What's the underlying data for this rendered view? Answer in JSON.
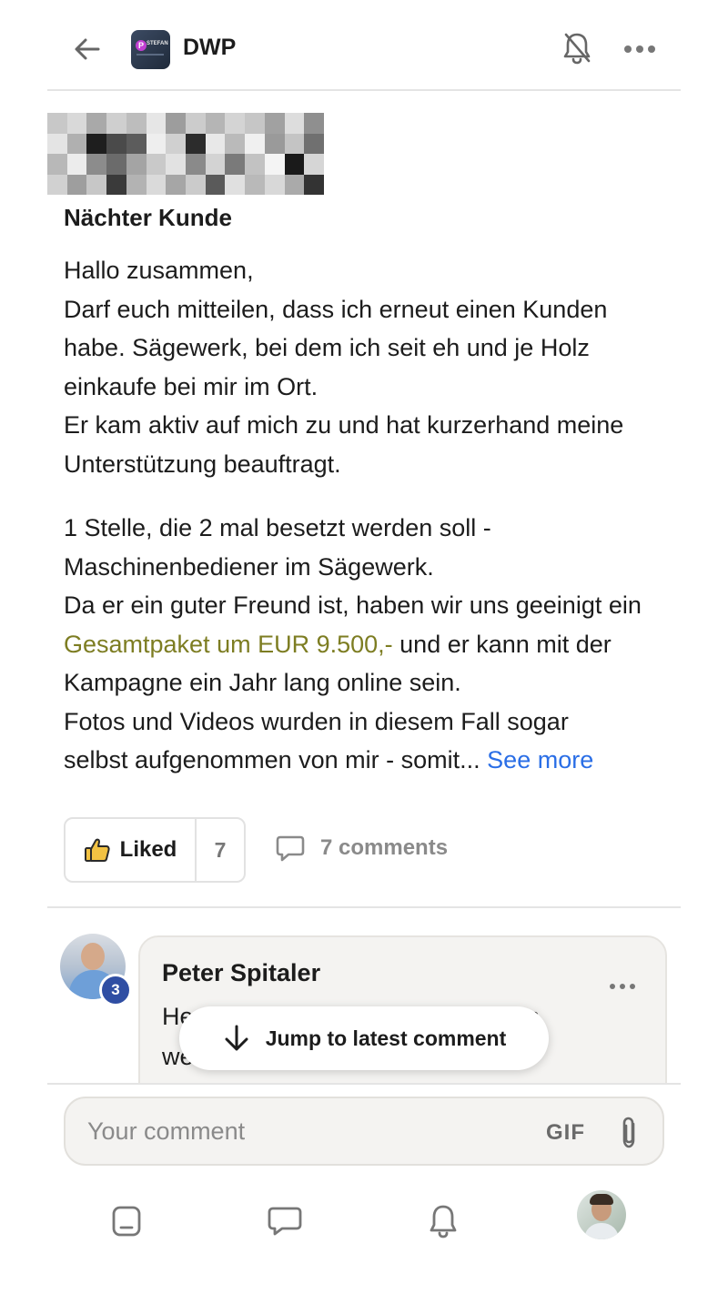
{
  "header": {
    "group_name": "DWP",
    "logo_text": "STEFAN",
    "logo_letter": "P"
  },
  "post": {
    "title": "Nächter Kunde",
    "paragraph1": [
      "Hallo zusammen,",
      "Darf euch mitteilen, dass ich erneut einen Kunden",
      "habe. Sägewerk, bei dem ich seit eh und je Holz",
      "einkaufe bei mir im Ort.",
      "Er kam aktiv auf mich zu und hat kurzerhand meine",
      "Unterstützung beauftragt."
    ],
    "paragraph2_lines": [
      "1 Stelle, die 2 mal besetzt werden soll -",
      "Maschinenbediener im Sägewerk.",
      "Da er ein guter Freund ist, haben wir uns geeinigt ein"
    ],
    "highlighted": "Gesamtpaket um EUR 9.500,-",
    "after_highlight": " und er kann mit der",
    "paragraph2_rest": [
      "Kampagne ein Jahr lang online sein.",
      "Fotos und Videos wurden in diesem Fall sogar"
    ],
    "last_line": "selbst aufgenommen von mir - somit... ",
    "see_more": "See more"
  },
  "reactions": {
    "liked_label": "Liked",
    "like_count": "7",
    "comments_label": "7 comments"
  },
  "comment": {
    "author": "Peter Spitaler",
    "level": "3",
    "line1_start": "He",
    "line1_end": "n",
    "line2_start": "we"
  },
  "jump": {
    "label": "Jump to latest comment"
  },
  "composer": {
    "placeholder": "Your comment",
    "gif_label": "GIF"
  },
  "colors": {
    "link": "#2a6ee6",
    "highlight": "#f5f03c",
    "badge": "#2f4ea3"
  }
}
